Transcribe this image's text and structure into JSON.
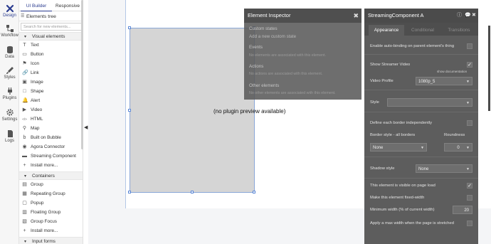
{
  "rail": [
    {
      "label": "Design",
      "icon": "design-icon",
      "active": true
    },
    {
      "label": "Workflow",
      "icon": "workflow-icon"
    },
    {
      "label": "Data",
      "icon": "database-icon"
    },
    {
      "label": "Styles",
      "icon": "brush-icon"
    },
    {
      "label": "Plugins",
      "icon": "plug-icon"
    },
    {
      "label": "Settings",
      "icon": "gear-icon"
    },
    {
      "label": "Logs",
      "icon": "file-icon"
    }
  ],
  "panel": {
    "tabs": [
      "UI Builder",
      "Responsive"
    ],
    "tree_label": "Elements tree",
    "search_placeholder": "Search for new elements...",
    "visual_section": "Visual elements",
    "visual_items": [
      {
        "label": "Text",
        "icon": "T"
      },
      {
        "label": "Button",
        "icon": "▭"
      },
      {
        "label": "Icon",
        "icon": "⚑"
      },
      {
        "label": "Link",
        "icon": "🔗"
      },
      {
        "label": "Image",
        "icon": "▣"
      },
      {
        "label": "Shape",
        "icon": "□"
      },
      {
        "label": "Alert",
        "icon": "🔔"
      },
      {
        "label": "Video",
        "icon": "▶"
      },
      {
        "label": "HTML",
        "icon": "</>"
      },
      {
        "label": "Map",
        "icon": "⚲"
      },
      {
        "label": "Built on Bubble",
        "icon": "b"
      },
      {
        "label": "Agora Connector",
        "icon": "◉"
      },
      {
        "label": "Streaming Component",
        "icon": "▬"
      },
      {
        "label": "Install more...",
        "icon": "+"
      }
    ],
    "containers_section": "Containers",
    "container_items": [
      {
        "label": "Group",
        "icon": "▤"
      },
      {
        "label": "Repeating Group",
        "icon": "▦"
      },
      {
        "label": "Popup",
        "icon": "▢"
      },
      {
        "label": "Floating Group",
        "icon": "▥"
      },
      {
        "label": "Group Focus",
        "icon": "▧"
      },
      {
        "label": "Install more...",
        "icon": "+"
      }
    ],
    "inputs_section": "Input forms"
  },
  "canvas": {
    "placeholder": "(no plugin preview available)"
  },
  "inspector": {
    "title": "Element Inspector",
    "custom_states": "Custom states",
    "add_custom_state": "Add a new custom state",
    "events": "Events",
    "events_empty": "No elements are associated with this element.",
    "actions": "Actions",
    "actions_empty": "No actions are associated with this element.",
    "other": "Other elements",
    "other_empty": "No other elements are associated with this element."
  },
  "props": {
    "title": "StreamingComponent A",
    "tabs": [
      "Appearance",
      "Conditional",
      "Transitions"
    ],
    "auto_binding": "Enable auto-binding on parent element's thing",
    "show_streamer_video": "Show Streamer Video",
    "show_documentation": "show documentation",
    "video_profile_label": "Video Profile",
    "video_profile_value": "1080p_5",
    "style_label": "Style",
    "define_border": "Define each border independently",
    "border_style_label": "Border style - all borders",
    "roundness_label": "Roundness",
    "border_style_value": "None",
    "roundness_value": "0",
    "shadow_label": "Shadow style",
    "shadow_value": "None",
    "visible_on_load": "This element is visible on page load",
    "fixed_width": "Make this element fixed-width",
    "min_width_label": "Minimum width (% of current width)",
    "min_width_value": "20",
    "max_width_label": "Apply a max width when the page is stretched"
  }
}
